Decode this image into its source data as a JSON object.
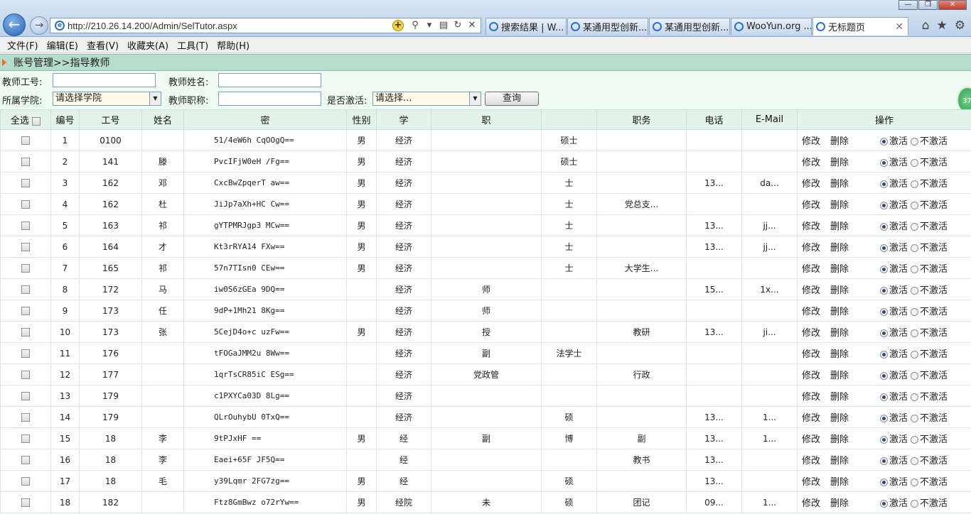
{
  "window": {
    "minimize": "—",
    "maximize": "❐",
    "close": "✕"
  },
  "browser": {
    "url": "http://210.26.14.200/Admin/SelTutor.aspx",
    "tabs": [
      {
        "label": "搜索结果 | W..."
      },
      {
        "label": "某通用型创新..."
      },
      {
        "label": "某通用型创新..."
      },
      {
        "label": "WooYun.org ..."
      },
      {
        "label": "无标题页"
      }
    ],
    "icons": [
      "home-icon",
      "star-icon",
      "gear-icon"
    ]
  },
  "menu": [
    "文件(F)",
    "编辑(E)",
    "查看(V)",
    "收藏夹(A)",
    "工具(T)",
    "帮助(H)"
  ],
  "breadcrumb": "账号管理>>指导教师",
  "filters": {
    "teacher_id_label": "教师工号:",
    "teacher_name_label": "教师姓名:",
    "college_label": "所属学院:",
    "college_value": "请选择学院",
    "title_label": "教师职称:",
    "active_label": "是否激活:",
    "active_value": "请选择...",
    "query_button": "查询"
  },
  "badge": "37",
  "table": {
    "headers": [
      "全选",
      "编号",
      "工号",
      "姓名",
      "密",
      "性别",
      "学",
      "职",
      "",
      "职务",
      "电话",
      "E-Mail",
      "操作"
    ],
    "edit": "修改",
    "delete": "删除",
    "active": "激活",
    "inactive": "不激活",
    "rows": [
      {
        "no": "1",
        "id": "0100",
        "name": "",
        "pw": "51/4eW6h    CqOOgQ==",
        "sex": "男",
        "col": "经济",
        "title": "",
        "deg": "硕士",
        "duty": "",
        "tel": "",
        "mail": ""
      },
      {
        "no": "2",
        "id": "141",
        "name": "滕",
        "pw": "PvcIFjW0eH      /Fg==",
        "sex": "男",
        "col": "经济",
        "title": "",
        "deg": "硕士",
        "duty": "",
        "tel": "",
        "mail": ""
      },
      {
        "no": "3",
        "id": "162",
        "name": "邓",
        "pw": "CxcBwZpqerT      aw==",
        "sex": "男",
        "col": "经济",
        "title": "",
        "deg": "士",
        "duty": "",
        "tel": "13...",
        "mail": "da..."
      },
      {
        "no": "4",
        "id": "162",
        "name": "杜",
        "pw": "JiJp7aXh+HC      Cw==",
        "sex": "男",
        "col": "经济",
        "title": "",
        "deg": "士",
        "duty": "党总支...",
        "tel": "",
        "mail": ""
      },
      {
        "no": "5",
        "id": "163",
        "name": "祁",
        "pw": "gYTPMRJgp3      MCw==",
        "sex": "男",
        "col": "经济",
        "title": "",
        "deg": "士",
        "duty": "",
        "tel": "13...",
        "mail": "jj..."
      },
      {
        "no": "6",
        "id": "164",
        "name": "才",
        "pw": "Kt3rRYA14      FXw==",
        "sex": "男",
        "col": "经济",
        "title": "",
        "deg": "士",
        "duty": "",
        "tel": "13...",
        "mail": "jj..."
      },
      {
        "no": "7",
        "id": "165",
        "name": "祁",
        "pw": "57n7TIsn0      CEw==",
        "sex": "男",
        "col": "经济",
        "title": "",
        "deg": "士",
        "duty": "大学生...",
        "tel": "",
        "mail": ""
      },
      {
        "no": "8",
        "id": "172",
        "name": "马",
        "pw": "iw0S6zGEa      9DQ==",
        "sex": "",
        "col": "经济",
        "title": "师",
        "deg": "",
        "duty": "",
        "tel": "15...",
        "mail": "1x..."
      },
      {
        "no": "9",
        "id": "173",
        "name": "任",
        "pw": "9dP+1Mh21      8Kg==",
        "sex": "",
        "col": "经济",
        "title": "师",
        "deg": "",
        "duty": "",
        "tel": "",
        "mail": ""
      },
      {
        "no": "10",
        "id": "173",
        "name": "张",
        "pw": "5CejD4o+c      uzFw==",
        "sex": "男",
        "col": "经济",
        "title": "授",
        "deg": "",
        "duty": "教研",
        "tel": "13...",
        "mail": "ji..."
      },
      {
        "no": "11",
        "id": "176",
        "name": "",
        "pw": "tFOGaJMM2u      8Ww==",
        "sex": "",
        "col": "经济",
        "title": "副",
        "deg": "法学士",
        "duty": "",
        "tel": "",
        "mail": ""
      },
      {
        "no": "12",
        "id": "177",
        "name": "",
        "pw": "1qrTsCR85iC      ESg==",
        "sex": "",
        "col": "经济",
        "title": "党政管",
        "deg": "",
        "duty": "行政",
        "tel": "",
        "mail": ""
      },
      {
        "no": "13",
        "id": "179",
        "name": "",
        "pw": "c1PXYCa03D      8Lg==",
        "sex": "",
        "col": "经济",
        "title": "",
        "deg": "",
        "duty": "",
        "tel": "",
        "mail": ""
      },
      {
        "no": "14",
        "id": "179",
        "name": "",
        "pw": "QLrOuhybU      0TxQ==",
        "sex": "",
        "col": "经济",
        "title": "",
        "deg": "硕",
        "duty": "",
        "tel": "13...",
        "mail": "1..."
      },
      {
        "no": "15",
        "id": "18",
        "name": "李",
        "pw": "9tPJxHF      ==",
        "sex": "男",
        "col": "经",
        "title": "副",
        "deg": "博",
        "duty": "副",
        "tel": "13...",
        "mail": "1..."
      },
      {
        "no": "16",
        "id": "18",
        "name": "李",
        "pw": "Eaei+65F      JF5Q==",
        "sex": "",
        "col": "经",
        "title": "",
        "deg": "",
        "duty": "教书",
        "tel": "13...",
        "mail": ""
      },
      {
        "no": "17",
        "id": "18",
        "name": "毛",
        "pw": "y39Lqmr      2FG7zg==",
        "sex": "男",
        "col": "经",
        "title": "",
        "deg": "硕",
        "duty": "",
        "tel": "13...",
        "mail": ""
      },
      {
        "no": "18",
        "id": "182",
        "name": "",
        "pw": "Ftz8GmBwz      o72rYw==",
        "sex": "男",
        "col": "经院",
        "title": "未",
        "deg": "硕",
        "duty": "团记",
        "tel": "09...",
        "mail": "1..."
      }
    ]
  }
}
